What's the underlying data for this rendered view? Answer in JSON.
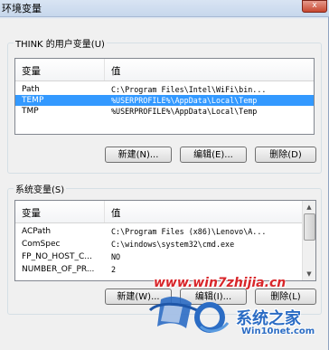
{
  "window": {
    "title": "环境变量",
    "close_label": "x"
  },
  "user_vars": {
    "group_label": "THINK 的用户变量(U)",
    "col_name": "变量",
    "col_value": "值",
    "rows": [
      {
        "name": "Path",
        "value": "C:\\Program Files\\Intel\\WiFi\\bin...",
        "selected": false
      },
      {
        "name": "TEMP",
        "value": "%USERPROFILE%\\AppData\\Local\\Temp",
        "selected": true
      },
      {
        "name": "TMP",
        "value": "%USERPROFILE%\\AppData\\Local\\Temp",
        "selected": false
      }
    ],
    "new_label": "新建(N)...",
    "edit_label": "编辑(E)...",
    "delete_label": "删除(D)"
  },
  "sys_vars": {
    "group_label": "系统变量(S)",
    "col_name": "变量",
    "col_value": "值",
    "rows": [
      {
        "name": "ACPath",
        "value": "C:\\Program Files (x86)\\Lenovo\\A..."
      },
      {
        "name": "ComSpec",
        "value": "C:\\windows\\system32\\cmd.exe"
      },
      {
        "name": "FP_NO_HOST_C...",
        "value": "NO"
      },
      {
        "name": "NUMBER_OF_PR...",
        "value": "2"
      }
    ],
    "new_label": "新建(W)...",
    "edit_label": "编辑(I)...",
    "delete_label": "删除(L)"
  },
  "watermark": {
    "url": "www.win7zhijia.cn",
    "cn_name": "系统之家",
    "site": "Win10net.com"
  }
}
